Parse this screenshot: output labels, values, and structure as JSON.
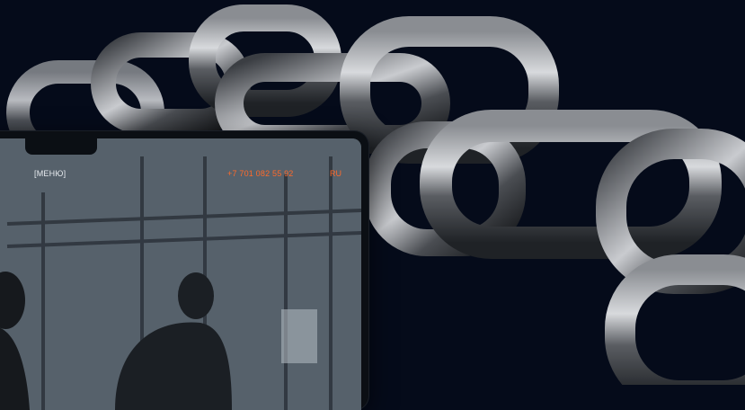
{
  "colors": {
    "background": "#050b1a",
    "accent": "#ff6a2a",
    "menu_text": "#e8ecf0"
  },
  "tablet": {
    "header": {
      "menu_label": "[МЕНЮ]",
      "phone": "+7 701 082 55 92",
      "language": "RU"
    },
    "hero_image": "athletes-training-in-gym-photo"
  },
  "decor": {
    "background_image": "metal-chain-3d-render"
  }
}
